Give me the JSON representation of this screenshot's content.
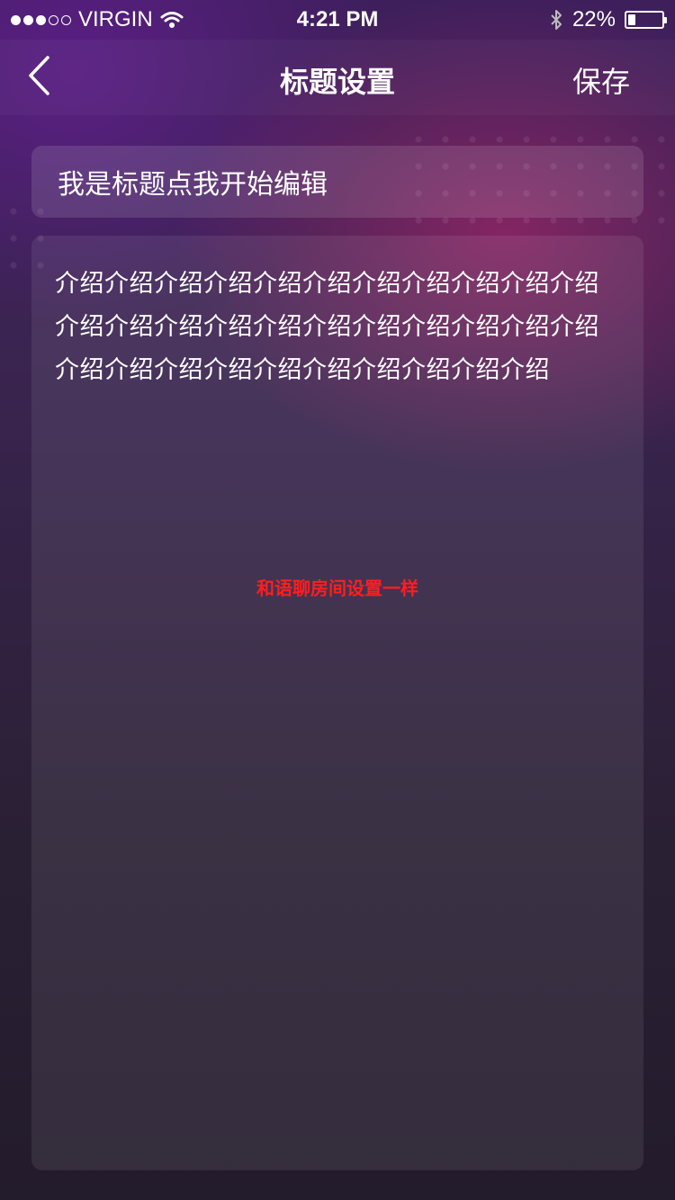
{
  "status_bar": {
    "carrier": "VIRGIN",
    "time": "4:21 PM",
    "battery_percent": "22%",
    "battery_level": 0.22,
    "signal_icon": "signal-dots-icon",
    "wifi_icon": "wifi-icon",
    "bluetooth_icon": "bluetooth-icon",
    "battery_icon": "battery-icon"
  },
  "nav": {
    "back_icon": "chevron-left-icon",
    "title": "标题设置",
    "save_label": "保存"
  },
  "form": {
    "title_value": "我是标题点我开始编辑",
    "intro_value": "介绍介绍介绍介绍介绍介绍介绍介绍介绍介绍介绍介绍介绍介绍介绍介绍介绍介绍介绍介绍介绍介绍介绍介绍介绍介绍介绍介绍介绍介绍介绍介绍"
  },
  "annotation": {
    "text": "和语聊房间设置一样",
    "color": "#ff1e1e"
  }
}
